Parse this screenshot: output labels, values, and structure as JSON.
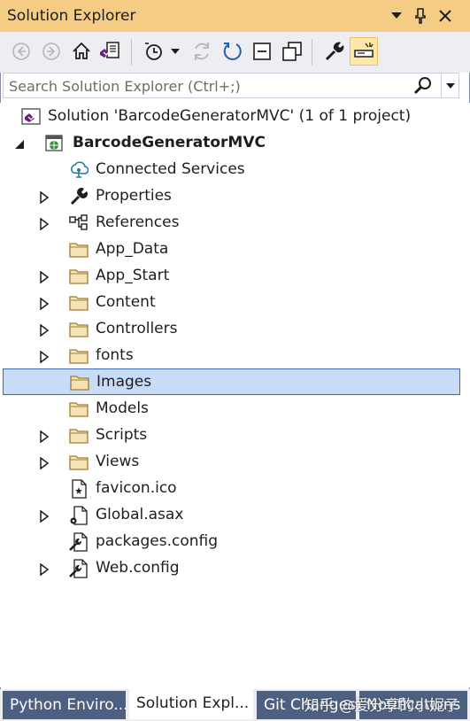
{
  "window": {
    "title": "Solution Explorer",
    "menu_glyph": "▼",
    "pin_glyph": "📌",
    "close_glyph": "✕"
  },
  "toolbar": {
    "icons": [
      "back-icon",
      "forward-icon",
      "home-icon",
      "switch-views-icon",
      "pending-changes-filter-icon",
      "refresh-icon",
      "sync-icon",
      "collapse-all-icon",
      "show-all-files-icon",
      "properties-icon",
      "preview-selected-icon"
    ]
  },
  "search": {
    "placeholder": "Search Solution Explorer (Ctrl+;)"
  },
  "tree": {
    "items": [
      {
        "label": "Solution 'BarcodeGeneratorMVC' (1 of 1 project)",
        "icon": "solution-icon",
        "expander": "none"
      },
      {
        "label": "BarcodeGeneratorMVC",
        "icon": "web-project-icon",
        "expander": "expanded",
        "bold": true
      },
      {
        "label": "Connected Services",
        "icon": "connected-services-icon",
        "expander": "none"
      },
      {
        "label": "Properties",
        "icon": "wrench-icon",
        "expander": "collapsed"
      },
      {
        "label": "References",
        "icon": "references-icon",
        "expander": "collapsed"
      },
      {
        "label": "App_Data",
        "icon": "folder-icon",
        "expander": "none"
      },
      {
        "label": "App_Start",
        "icon": "folder-icon",
        "expander": "collapsed"
      },
      {
        "label": "Content",
        "icon": "folder-icon",
        "expander": "collapsed"
      },
      {
        "label": "Controllers",
        "icon": "folder-icon",
        "expander": "collapsed"
      },
      {
        "label": "fonts",
        "icon": "folder-icon",
        "expander": "collapsed"
      },
      {
        "label": "Images",
        "icon": "folder-icon",
        "expander": "none",
        "selected": true
      },
      {
        "label": "Models",
        "icon": "folder-icon",
        "expander": "none"
      },
      {
        "label": "Scripts",
        "icon": "folder-icon",
        "expander": "collapsed"
      },
      {
        "label": "Views",
        "icon": "folder-icon",
        "expander": "collapsed"
      },
      {
        "label": "favicon.ico",
        "icon": "ico-file-icon",
        "expander": "none"
      },
      {
        "label": "Global.asax",
        "icon": "asax-file-icon",
        "expander": "collapsed"
      },
      {
        "label": "packages.config",
        "icon": "config-file-icon",
        "expander": "none"
      },
      {
        "label": "Web.config",
        "icon": "config-file-icon",
        "expander": "collapsed"
      }
    ]
  },
  "tabs": [
    {
      "label": "Python Enviro..."
    },
    {
      "label": "Solution Expl...",
      "active": true
    },
    {
      "label": "Git Changes"
    },
    {
      "label": "Notifications"
    }
  ],
  "watermark": "知乎 @爱分享的小妮子",
  "colors": {
    "title_bar": "#f5cc84",
    "toolbar": "#eeeef2",
    "selection": "#c9dcf7",
    "selection_border": "#3a6ab5",
    "tab_inactive": "#4d6082",
    "folder": "#dcb67a"
  }
}
